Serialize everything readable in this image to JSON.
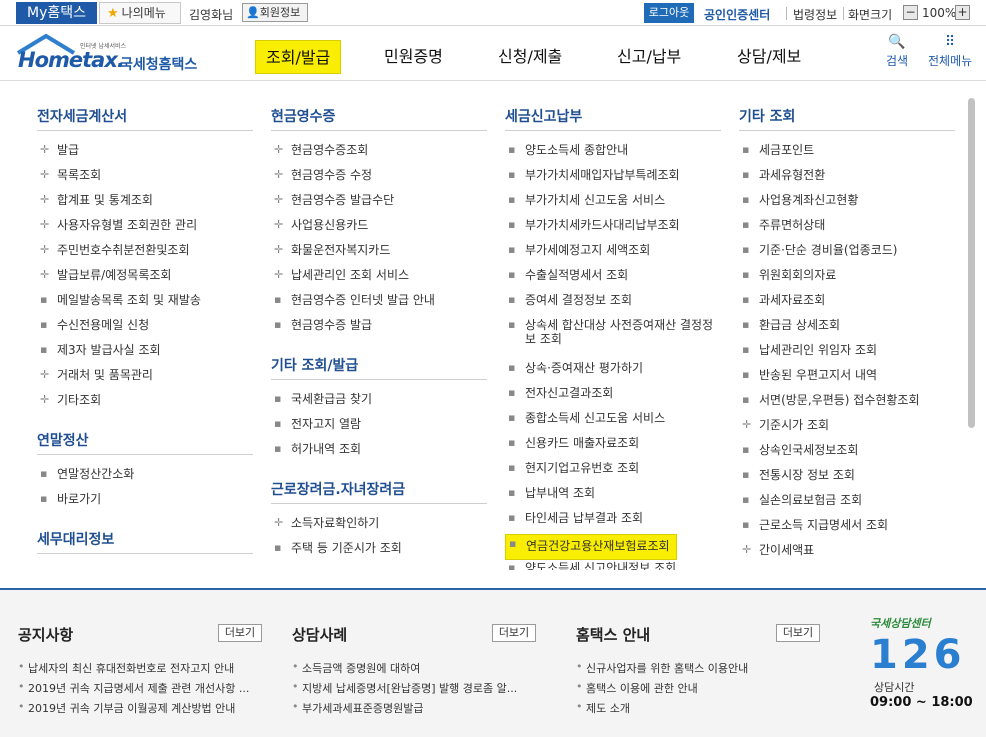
{
  "topbar": {
    "my_hometax": "My홈택스",
    "my_menu": "나의메뉴",
    "user_name": "김영화님",
    "member_info": "회원정보",
    "logout": "로그아웃",
    "certificate": "공인인증센터",
    "law_info": "법령정보",
    "zoom_label": "화면크기",
    "zoom_value": "100%",
    "zoom_minus": "−",
    "zoom_plus": "+"
  },
  "header": {
    "logo_small": "인터넷 납세서비스",
    "logo_main": "Hometax.",
    "logo_sub": "국세청홈택스",
    "nav": [
      "조회/발급",
      "민원증명",
      "신청/제출",
      "신고/납부",
      "상담/제보"
    ],
    "search": "검색",
    "all_menu": "전체메뉴"
  },
  "menu": {
    "col1": {
      "groups": [
        {
          "title": "전자세금계산서",
          "items": [
            "발급",
            "목록조회",
            "합계표 및 통계조회",
            "사용자유형별 조회권한 관리",
            "주민번호수취분전환및조회",
            "발급보류/예정목록조회",
            "메일발송목록 조회 및 재발송",
            "수신전용메일 신청",
            "제3자 발급사실 조회",
            "거래처 및 품목관리",
            "기타조회"
          ]
        },
        {
          "title": "연말정산",
          "items": [
            "연말정산간소화",
            "바로가기"
          ]
        },
        {
          "title": "세무대리정보",
          "items": []
        }
      ]
    },
    "col2": {
      "groups": [
        {
          "title": "현금영수증",
          "items": [
            "현금영수증조회",
            "현금영수증 수정",
            "현금영수증 발급수단",
            "사업용신용카드",
            "화물운전자복지카드",
            "납세관리인 조회 서비스",
            "현금영수증 인터넷 발급 안내",
            "현금영수증 발급"
          ]
        },
        {
          "title": "기타 조회/발급",
          "items": [
            "국세환급금 찾기",
            "전자고지 열람",
            "허가내역 조회"
          ]
        },
        {
          "title": "근로장려금.자녀장려금",
          "items": [
            "소득자료확인하기",
            "주택 등 기준시가 조회"
          ]
        }
      ]
    },
    "col3": {
      "groups": [
        {
          "title": "세금신고납부",
          "items": [
            "양도소득세 종합안내",
            "부가가치세매입자납부특례조회",
            "부가가치세 신고도움 서비스",
            "부가가치세카드사대리납부조회",
            "부가세예정고지 세액조회",
            "수출실적명세서 조회",
            "증여세 결정정보 조회",
            "상속세 합산대상 사전증여재산 결정정보 조회",
            "상속·증여재산 평가하기",
            "전자신고결과조회",
            "종합소득세 신고도움 서비스",
            "신용카드 매출자료조회",
            "현지기업고유번호 조회",
            "납부내역 조회",
            "타인세금 납부결과 조회",
            "연금건강고용산재보험료조회",
            "양도소득세 신고안내정보 조회"
          ]
        }
      ]
    },
    "col4": {
      "groups": [
        {
          "title": "기타 조회",
          "items": [
            "세금포인트",
            "과세유형전환",
            "사업용계좌신고현황",
            "주류면허상태",
            "기준·단순 경비율(업종코드)",
            "위원회회의자료",
            "과세자료조회",
            "환급금 상세조회",
            "납세관리인 위임자 조회",
            "반송된 우편고지서 내역",
            "서면(방문,우편등) 접수현황조회",
            "기준시가 조회",
            "상속인국세정보조회",
            "전통시장 정보 조회",
            "실손의료보험금 조회",
            "근로소득 지급명세서 조회",
            "간이세액표"
          ]
        }
      ]
    }
  },
  "footer": {
    "notice": {
      "title": "공지사항",
      "more": "더보기",
      "items": [
        "납세자의 최신 휴대전화번호로 전자고지 안내",
        "2019년 귀속 지급명세서 제출 관련 개선사항 ...",
        "2019년 귀속 기부금 이월공제 계산방법 안내"
      ]
    },
    "consult": {
      "title": "상담사례",
      "more": "더보기",
      "items": [
        "소득금액 증명원에 대하여",
        "지방세 납세증명서[완납증명] 발행 경로좀 알...",
        "부가세과세표준증명원발급"
      ]
    },
    "guide": {
      "title": "홈택스 안내",
      "more": "더보기",
      "items": [
        "신규사업자를 위한 홈택스 이용안내",
        "홈택스 이용에 관한 안내",
        "제도 소개"
      ]
    },
    "center": {
      "top": "국세상담센터",
      "number": "126",
      "hours_label": "상담시간",
      "hours": "09:00 ~ 18:00"
    }
  }
}
